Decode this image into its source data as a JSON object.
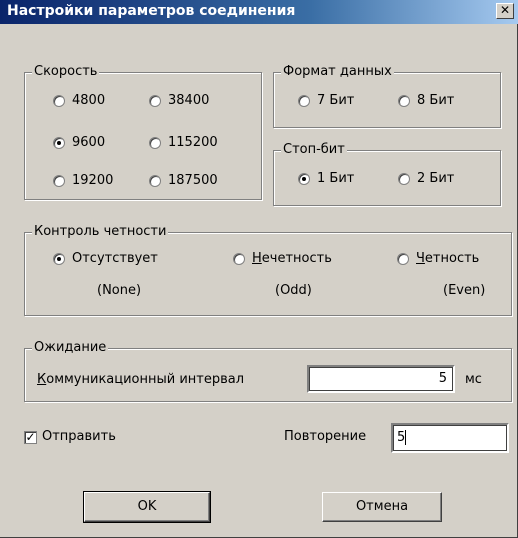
{
  "window": {
    "title": "Настройки параметров соединения",
    "close_glyph": "✕"
  },
  "speed": {
    "legend": "Скорость",
    "options": [
      "4800",
      "38400",
      "9600",
      "115200",
      "19200",
      "187500"
    ],
    "selected": "9600"
  },
  "data_format": {
    "legend": "Формат данных",
    "options": [
      "7 Бит",
      "8 Бит"
    ],
    "selected": ""
  },
  "stop_bits": {
    "legend": "Стоп-бит",
    "options": [
      "1 Бит",
      "2 Бит"
    ],
    "selected": "1 Бит"
  },
  "parity": {
    "legend": "Контроль четности",
    "options": [
      {
        "prefix": "",
        "underlined": "",
        "rest": "Отсутствует",
        "sub": "(None)"
      },
      {
        "prefix": "",
        "underlined": "Н",
        "rest": "ечетность",
        "sub": "(Odd)"
      },
      {
        "prefix": "",
        "underlined": "Ч",
        "rest": "етность",
        "sub": "(Even)"
      }
    ],
    "selected": "Отсутствует"
  },
  "timeout": {
    "legend": "Ожидание",
    "label_underlined": "К",
    "label_rest": "оммуникационный интервал",
    "value": "5",
    "unit": "мс"
  },
  "send": {
    "label": "Отправить",
    "checked": true,
    "check_glyph": "✓"
  },
  "repeat": {
    "label": "Повторение",
    "value": "5"
  },
  "buttons": {
    "ok": "OK",
    "cancel": "Отмена"
  }
}
